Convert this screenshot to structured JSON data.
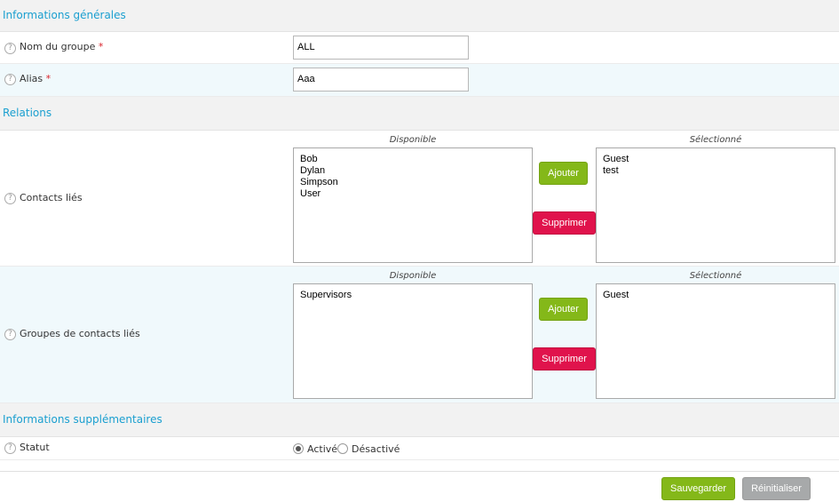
{
  "sections": {
    "general": "Informations générales",
    "relations": "Relations",
    "extra": "Informations supplémentaires"
  },
  "help_icon": "?",
  "required_marker": "*",
  "fields": {
    "group_name": {
      "label": "Nom du groupe",
      "value": "ALL"
    },
    "alias": {
      "label": "Alias",
      "value": "Aaa"
    },
    "contacts": {
      "label": "Contacts liés",
      "available_caption": "Disponible",
      "selected_caption": "Sélectionné",
      "available": [
        "Bob",
        "Dylan",
        "Simpson",
        "User"
      ],
      "selected": [
        "Guest",
        "test"
      ]
    },
    "contact_groups": {
      "label": "Groupes de contacts liés",
      "available_caption": "Disponible",
      "selected_caption": "Sélectionné",
      "available": [
        "Supervisors"
      ],
      "selected": [
        "Guest"
      ]
    },
    "status": {
      "label": "Statut",
      "options": [
        "Activé",
        "Désactivé"
      ],
      "selected": "Activé"
    }
  },
  "buttons": {
    "add": "Ajouter",
    "remove": "Supprimer",
    "save": "Sauvegarder",
    "reset": "Réinitialiser"
  },
  "colors": {
    "section_title": "#1a9fd0",
    "add_button": "#84b819",
    "remove_button": "#e0134c",
    "reset_button": "#a7a9aa"
  }
}
